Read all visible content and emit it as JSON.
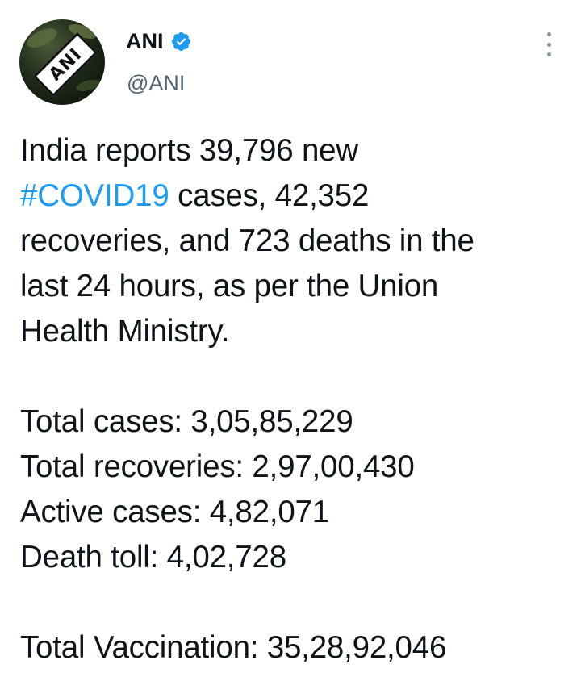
{
  "account": {
    "display_name": "ANI",
    "handle": "@ANI",
    "avatar_text": "ANI",
    "verified": true
  },
  "tweet": {
    "line1": "India reports 39,796 new",
    "hashtag": "#COVID19",
    "line2_rest": " cases, 42,352",
    "line3": "recoveries, and 723 deaths in the",
    "line4": "last 24 hours, as per the Union",
    "line5": "Health Ministry.",
    "total_cases": "Total cases: 3,05,85,229",
    "total_recoveries": "Total recoveries: 2,97,00,430",
    "active_cases": "Active cases: 4,82,071",
    "death_toll": "Death toll: 4,02,728",
    "total_vaccination": "Total Vaccination: 35,28,92,046"
  },
  "icons": {
    "verified": "verified-badge-icon",
    "more": "more-options-icon"
  },
  "colors": {
    "text": "#0f1419",
    "secondary": "#536471",
    "link": "#1d9bf0",
    "verified": "#1d9bf0"
  }
}
